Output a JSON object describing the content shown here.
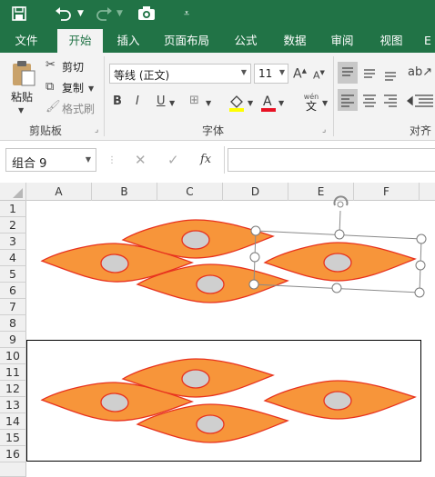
{
  "quick_access": {
    "save_icon": "save-icon",
    "undo_icon": "undo-icon",
    "redo_icon": "redo-icon",
    "camera_icon": "camera-icon",
    "customize_icon": "customize-icon"
  },
  "tabs": [
    "文件",
    "开始",
    "插入",
    "页面布局",
    "公式",
    "数据",
    "审阅",
    "视图",
    "E"
  ],
  "active_tab": "开始",
  "clipboard": {
    "paste": "粘贴",
    "cut": "剪切",
    "copy": "复制",
    "format_painter": "格式刷",
    "group": "剪贴板"
  },
  "font": {
    "name": "等线 (正文)",
    "size": "11",
    "group": "字体",
    "bold": "B",
    "italic": "I",
    "underline": "U",
    "wen": "wén",
    "wen_char": "文"
  },
  "align": {
    "group": "对齐"
  },
  "name_box": "组合 9",
  "fx_label": "fx",
  "formula_value": "",
  "columns": [
    "A",
    "B",
    "C",
    "D",
    "E",
    "F"
  ],
  "rows": [
    "1",
    "2",
    "3",
    "4",
    "5",
    "6",
    "7",
    "8",
    "9",
    "10",
    "11",
    "12",
    "13",
    "14",
    "15",
    "16"
  ],
  "colors": {
    "ribbon_green": "#217346",
    "cell_fill": "#f7953a",
    "cell_outline": "#e8321e",
    "nucleus_fill": "#cfcfcf"
  },
  "shapes_upper": "group of 4 cell shapes",
  "shapes_lower": "group of 4 cell shapes"
}
